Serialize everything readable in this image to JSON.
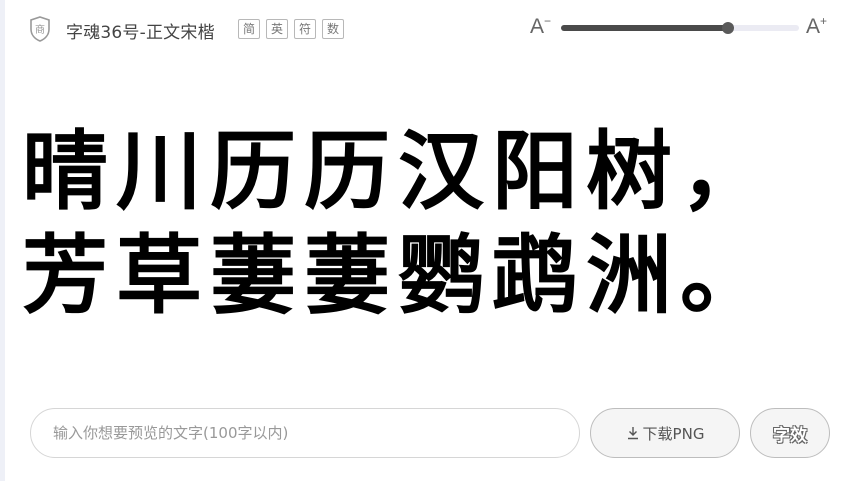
{
  "header": {
    "shield_glyph": "商",
    "font_name": "字魂36号-正文宋楷",
    "tags": [
      "简",
      "英",
      "符",
      "数"
    ],
    "size_decrease_label": "A",
    "size_decrease_sup": "−",
    "size_increase_label": "A",
    "size_increase_sup": "+",
    "slider_level": 0.7
  },
  "preview": {
    "lines": [
      "晴川历历汉阳树，",
      "芳草萋萋鹦鹉洲。"
    ]
  },
  "footer": {
    "input_value": "",
    "input_placeholder": "输入你想要预览的文字(100字以内)",
    "download_label": "下载PNG",
    "effect_label": "字效"
  },
  "colors": {
    "slider_fill": "#4a4a4a",
    "slider_track": "#ebebf3",
    "button_bg": "#f5f5f5"
  },
  "icons": {
    "shield": "shield-icon",
    "download": "download-icon"
  }
}
